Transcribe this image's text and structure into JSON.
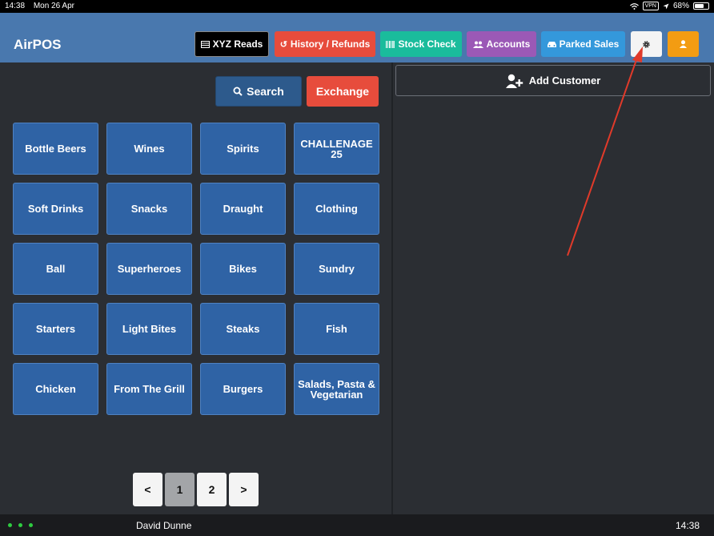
{
  "status_bar": {
    "time": "14:38",
    "date": "Mon 26 Apr",
    "vpn": "VPN",
    "battery": "68%",
    "battery_level": 0.68
  },
  "header": {
    "brand": "AirPOS",
    "buttons": {
      "xyz_reads": {
        "label": "XYZ Reads",
        "color": "#000000"
      },
      "history": {
        "label": "History / Refunds",
        "color": "#e74c3c"
      },
      "stock_check": {
        "label": "Stock Check",
        "color": "#1abc9c"
      },
      "accounts": {
        "label": "Accounts",
        "color": "#9b59b6"
      },
      "parked_sales": {
        "label": "Parked Sales",
        "color": "#3498db"
      },
      "settings": {
        "icon": "gear-icon",
        "color": "#f4f4f4"
      },
      "user": {
        "icon": "user-icon",
        "color": "#f39c12"
      }
    }
  },
  "actions": {
    "search": "Search",
    "exchange": "Exchange"
  },
  "categories": [
    "Bottle Beers",
    "Wines",
    "Spirits",
    "CHALLENAGE 25",
    "Soft Drinks",
    "Snacks",
    "Draught",
    "Clothing",
    "Ball",
    "Superheroes",
    "Bikes",
    "Sundry",
    "Starters",
    "Light Bites",
    "Steaks",
    "Fish",
    "Chicken",
    "From The Grill",
    "Burgers",
    "Salads, Pasta & Vegetarian"
  ],
  "pagination": {
    "prev": "<",
    "pages": [
      "1",
      "2"
    ],
    "next": ">",
    "current": "1"
  },
  "customer_panel": {
    "add_customer": "Add Customer"
  },
  "footer": {
    "user": "David Dunne",
    "time": "14:38"
  },
  "annotation": {
    "type": "arrow",
    "color": "#e03a2a",
    "points_to": "settings-button"
  }
}
